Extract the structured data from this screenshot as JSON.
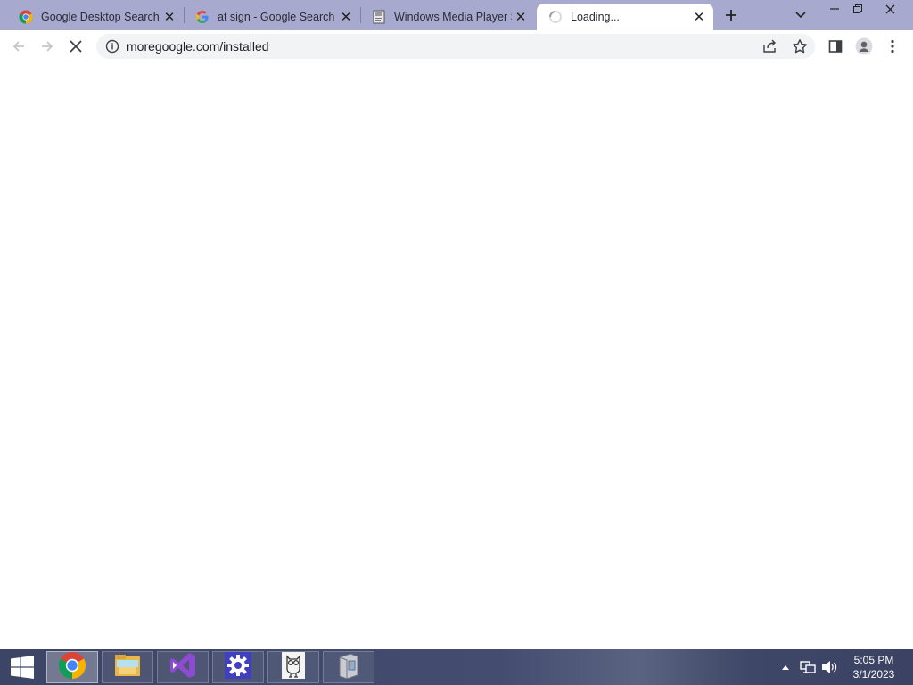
{
  "browser": {
    "tabs": [
      {
        "title": "Google Desktop Search F",
        "favicon": "chrome-icon",
        "active": false
      },
      {
        "title": "at sign - Google Search",
        "favicon": "google-g-icon",
        "active": false
      },
      {
        "title": "Windows Media Player S",
        "favicon": "page-thumbnail-icon",
        "active": false
      },
      {
        "title": "Loading...",
        "favicon": "loading-spinner-icon",
        "active": true
      }
    ],
    "new_tab_icon": "plus-icon",
    "tab_search_icon": "chevron-down-icon",
    "window_controls": [
      "minimize-icon",
      "restore-icon",
      "close-icon"
    ]
  },
  "toolbar": {
    "back_icon": "back-arrow-icon",
    "forward_icon": "forward-arrow-icon",
    "stop_icon": "stop-loading-icon",
    "site_info_icon": "info-icon",
    "url": "moregoogle.com/installed",
    "share_icon": "share-icon",
    "bookmark_icon": "star-icon",
    "side_panel_icon": "side-panel-icon",
    "profile_icon": "profile-icon",
    "menu_icon": "kebab-menu-icon"
  },
  "taskbar": {
    "start_icon": "windows-logo-icon",
    "apps": [
      {
        "name": "chrome-icon",
        "active": true
      },
      {
        "name": "file-explorer-icon",
        "active": false
      },
      {
        "name": "visual-studio-icon",
        "active": false
      },
      {
        "name": "settings-gear-icon",
        "active": false
      },
      {
        "name": "owl-app-icon",
        "active": false
      },
      {
        "name": "package-app-icon",
        "active": false
      }
    ],
    "tray_icons": [
      "show-hidden-icons-arrow",
      "network-icon",
      "volume-icon"
    ],
    "clock": {
      "time": "5:05 PM",
      "date": "3/1/2023"
    }
  },
  "colors": {
    "tabstrip": "#a7a9cf",
    "omnibox": "#f1f3f4",
    "taskbar": "#414a6c",
    "visual_studio_purple": "#68217a",
    "settings_blue": "#3f3fbf"
  }
}
